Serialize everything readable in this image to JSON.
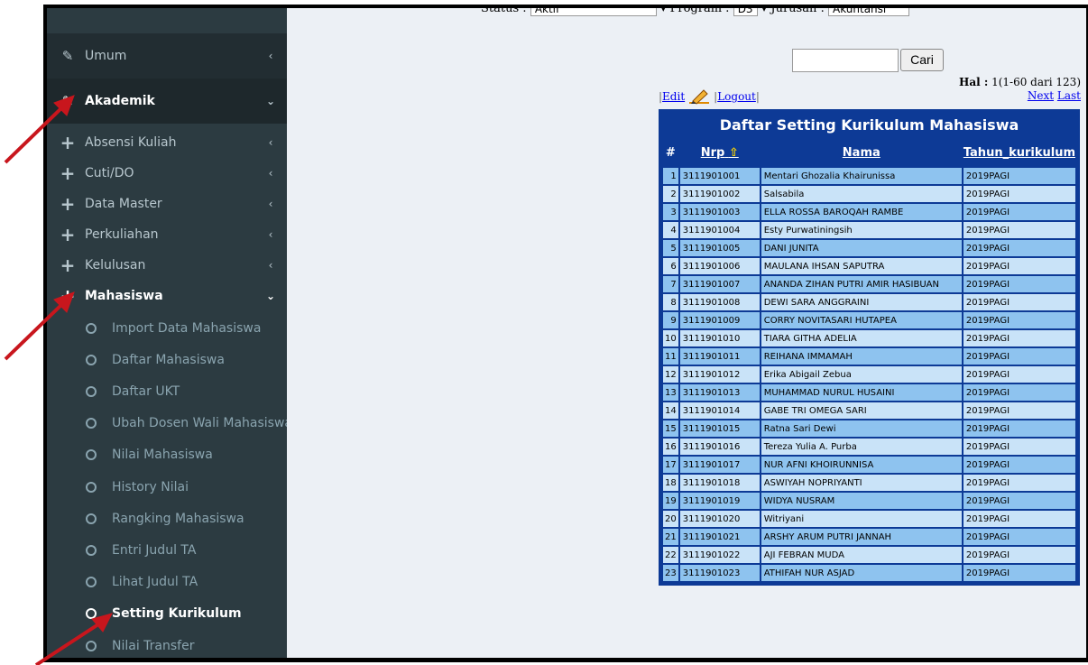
{
  "filter": {
    "status_label": "Status :",
    "status_value": "Aktif",
    "program_label": "Program :",
    "program_value": "D3",
    "jurusan_label": "Jurusan :",
    "jurusan_value": "Akuntansi"
  },
  "sidebar": {
    "top_items": [
      {
        "label": "Umum",
        "icon": "pencil-icon",
        "caret": "<"
      },
      {
        "label": "Akademik",
        "icon": "pencil-icon",
        "caret": "v"
      }
    ],
    "groups": [
      {
        "label": "Absensi Kuliah",
        "caret": "<"
      },
      {
        "label": "Cuti/DO",
        "caret": "<"
      },
      {
        "label": "Data Master",
        "caret": "<"
      },
      {
        "label": "Perkuliahan",
        "caret": "<"
      },
      {
        "label": "Kelulusan",
        "caret": "<"
      },
      {
        "label": "Mahasiswa",
        "caret": "v"
      }
    ],
    "sub_items": [
      "Import Data Mahasiswa",
      "Daftar Mahasiswa",
      "Daftar UKT",
      "Ubah Dosen Wali Mahasiswa",
      "Nilai Mahasiswa",
      "History Nilai",
      "Rangking Mahasiswa",
      "Entri Judul TA",
      "Lihat Judul TA",
      "Setting Kurikulum",
      "Nilai Transfer"
    ]
  },
  "search": {
    "value": "",
    "button_label": "Cari"
  },
  "paging": {
    "hal_label": "Hal :",
    "hal_value": "1(1-60 dari 123)",
    "next_label": "Next",
    "last_label": "Last"
  },
  "actions": {
    "edit_label": "Edit",
    "logout_label": "Logout"
  },
  "table": {
    "title": "Daftar Setting Kurikulum Mahasiswa",
    "headers": {
      "num": "#",
      "nrp": "Nrp",
      "nama": "Nama",
      "tahun": "Tahun_kurikulum"
    },
    "rows": [
      {
        "no": "1",
        "nrp": "3111901001",
        "nama": "Mentari Ghozalia Khairunissa",
        "tahun": "2019PAGI"
      },
      {
        "no": "2",
        "nrp": "3111901002",
        "nama": "Salsabila",
        "tahun": "2019PAGI"
      },
      {
        "no": "3",
        "nrp": "3111901003",
        "nama": "ELLA ROSSA BAROQAH RAMBE",
        "tahun": "2019PAGI"
      },
      {
        "no": "4",
        "nrp": "3111901004",
        "nama": "Esty Purwatiningsih",
        "tahun": "2019PAGI"
      },
      {
        "no": "5",
        "nrp": "3111901005",
        "nama": "DANI JUNITA",
        "tahun": "2019PAGI"
      },
      {
        "no": "6",
        "nrp": "3111901006",
        "nama": "MAULANA IHSAN SAPUTRA",
        "tahun": "2019PAGI"
      },
      {
        "no": "7",
        "nrp": "3111901007",
        "nama": "ANANDA ZIHAN PUTRI AMIR HASIBUAN",
        "tahun": "2019PAGI"
      },
      {
        "no": "8",
        "nrp": "3111901008",
        "nama": "DEWI SARA ANGGRAINI",
        "tahun": "2019PAGI"
      },
      {
        "no": "9",
        "nrp": "3111901009",
        "nama": "CORRY NOVITASARI HUTAPEA",
        "tahun": "2019PAGI"
      },
      {
        "no": "10",
        "nrp": "3111901010",
        "nama": "TIARA GITHA ADELIA",
        "tahun": "2019PAGI"
      },
      {
        "no": "11",
        "nrp": "3111901011",
        "nama": "REIHANA IMMAMAH",
        "tahun": "2019PAGI"
      },
      {
        "no": "12",
        "nrp": "3111901012",
        "nama": "Erika Abigail Zebua",
        "tahun": "2019PAGI"
      },
      {
        "no": "13",
        "nrp": "3111901013",
        "nama": "MUHAMMAD NURUL HUSAINI",
        "tahun": "2019PAGI"
      },
      {
        "no": "14",
        "nrp": "3111901014",
        "nama": "GABE TRI OMEGA SARI",
        "tahun": "2019PAGI"
      },
      {
        "no": "15",
        "nrp": "3111901015",
        "nama": "Ratna Sari Dewi",
        "tahun": "2019PAGI"
      },
      {
        "no": "16",
        "nrp": "3111901016",
        "nama": "Tereza Yulia A. Purba",
        "tahun": "2019PAGI"
      },
      {
        "no": "17",
        "nrp": "3111901017",
        "nama": "NUR AFNI KHOIRUNNISA",
        "tahun": "2019PAGI"
      },
      {
        "no": "18",
        "nrp": "3111901018",
        "nama": "ASWIYAH NOPRIYANTI",
        "tahun": "2019PAGI"
      },
      {
        "no": "19",
        "nrp": "3111901019",
        "nama": "WIDYA NUSRAM",
        "tahun": "2019PAGI"
      },
      {
        "no": "20",
        "nrp": "3111901020",
        "nama": "Witriyani",
        "tahun": "2019PAGI"
      },
      {
        "no": "21",
        "nrp": "3111901021",
        "nama": "ARSHY ARUM PUTRI JANNAH",
        "tahun": "2019PAGI"
      },
      {
        "no": "22",
        "nrp": "3111901022",
        "nama": "AJI FEBRAN MUDA",
        "tahun": "2019PAGI"
      },
      {
        "no": "23",
        "nrp": "3111901023",
        "nama": "ATHIFAH NUR ASJAD",
        "tahun": "2019PAGI"
      }
    ]
  },
  "colors": {
    "sidebar_bg": "#2c3b41",
    "table_header": "#0d3a96",
    "row_dark": "#8ec3ef",
    "row_light": "#c9e3f8",
    "annotation_arrow": "#c8161d"
  }
}
